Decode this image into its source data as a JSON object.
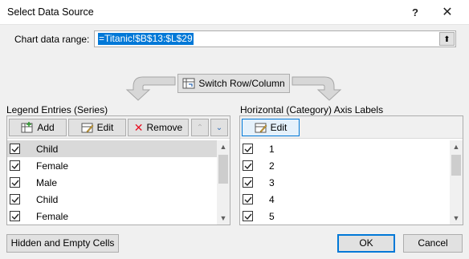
{
  "window": {
    "title": "Select Data Source",
    "help_glyph": "?",
    "close_glyph": "✕"
  },
  "range": {
    "label": "Chart data range:",
    "value": "=Titanic!$B$13:$L$29",
    "collapse_glyph": "⬆"
  },
  "switch": {
    "label": "Switch Row/Column"
  },
  "legend": {
    "label": "Legend Entries (Series)",
    "add_label": "Add",
    "edit_label": "Edit",
    "remove_label": "Remove",
    "up_glyph": "▲",
    "down_glyph": "▼",
    "items": [
      "Child",
      "Female",
      "Male",
      "Child",
      "Female"
    ],
    "selected_index": 0
  },
  "axis": {
    "label": "Horizontal (Category) Axis Labels",
    "edit_label": "Edit",
    "items": [
      "1",
      "2",
      "3",
      "4",
      "5"
    ]
  },
  "footer": {
    "hidden_label": "Hidden and Empty Cells",
    "ok_label": "OK",
    "cancel_label": "Cancel"
  },
  "colors": {
    "accent": "#0078d7",
    "remove_red": "#e81123"
  },
  "icons": [
    "add-series-icon",
    "edit-icon",
    "remove-x-icon",
    "switch-icon",
    "checkbox-check-icon"
  ]
}
